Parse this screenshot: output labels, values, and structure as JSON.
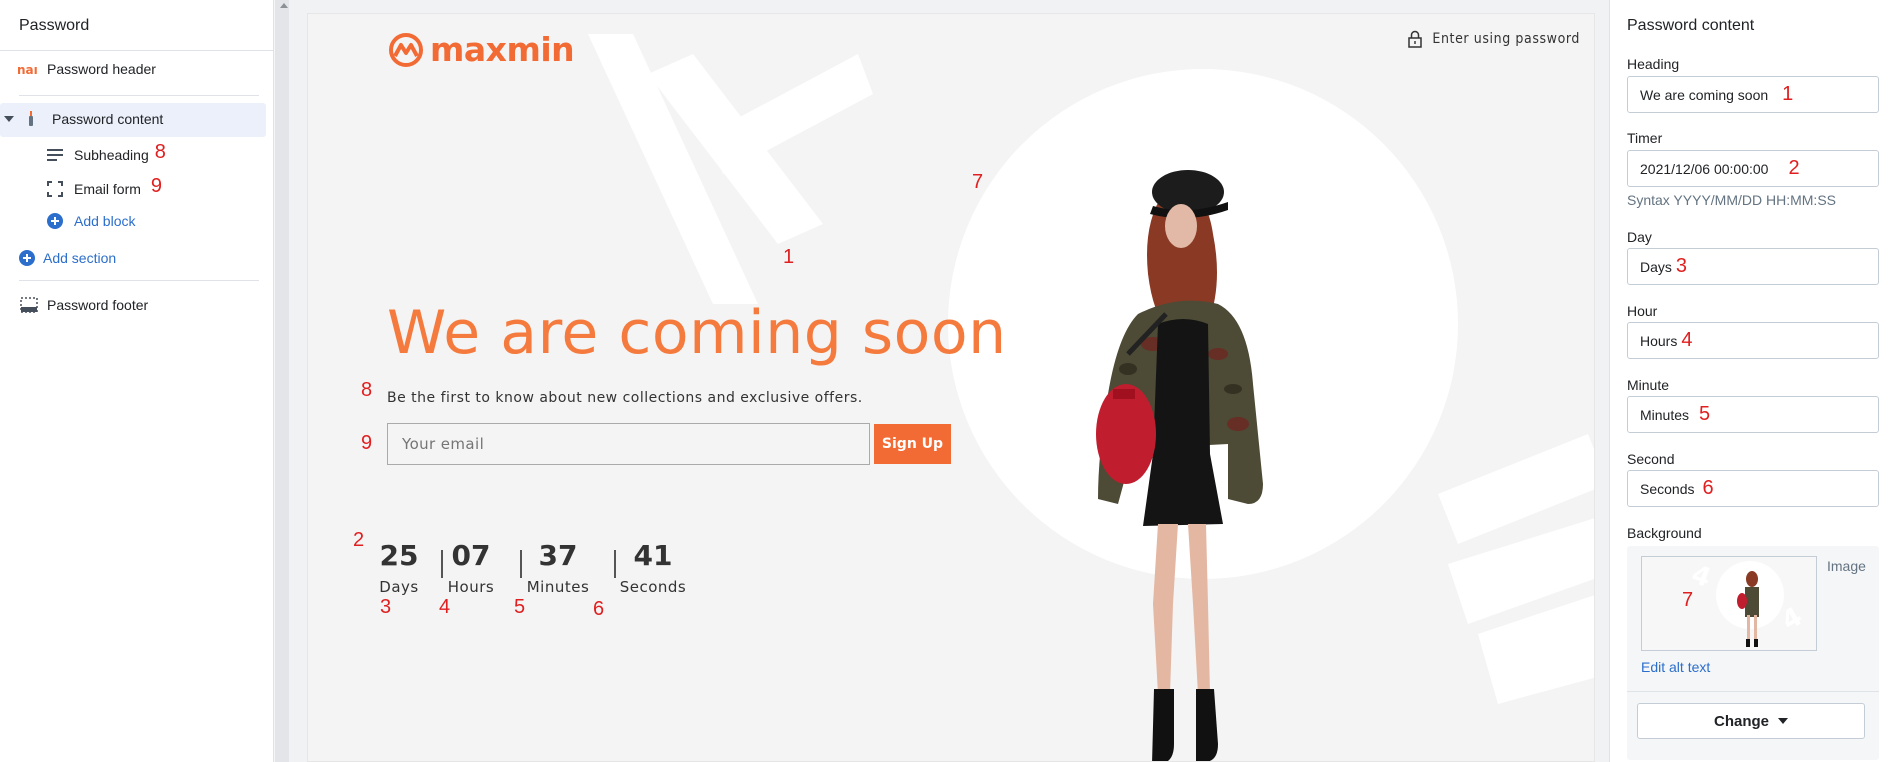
{
  "left": {
    "title": "Password",
    "items": [
      {
        "label": "Password header"
      },
      {
        "label": "Password content"
      },
      {
        "label": "Subheading"
      },
      {
        "label": "Email form"
      },
      {
        "label": "Add block"
      },
      {
        "label": "Add section"
      },
      {
        "label": "Password footer"
      }
    ]
  },
  "preview": {
    "logo_text": "maxmin",
    "enter_password": "Enter using password",
    "heading": "We are coming soon",
    "subheading": "Be the first to know about new collections and exclusive offers.",
    "email_placeholder": "Your email",
    "signup_label": "Sign Up",
    "countdown": [
      {
        "value": "25",
        "label": "Days"
      },
      {
        "value": "07",
        "label": "Hours"
      },
      {
        "value": "37",
        "label": "Minutes"
      },
      {
        "value": "41",
        "label": "Seconds"
      }
    ],
    "bg_text": "404"
  },
  "annotations": {
    "n1": "1",
    "n2": "2",
    "n3": "3",
    "n4": "4",
    "n5": "5",
    "n6": "6",
    "n7": "7",
    "n8": "8",
    "n9": "9"
  },
  "right": {
    "title": "Password content",
    "heading_label": "Heading",
    "heading_value": "We are coming soon",
    "timer_label": "Timer",
    "timer_value": "2021/12/06 00:00:00",
    "timer_hint": "Syntax YYYY/MM/DD HH:MM:SS",
    "day_label": "Day",
    "day_value": "Days",
    "hour_label": "Hour",
    "hour_value": "Hours",
    "minute_label": "Minute",
    "minute_value": "Minutes",
    "second_label": "Second",
    "second_value": "Seconds",
    "background_label": "Background",
    "image_label": "Image",
    "edit_alt": "Edit alt text",
    "change_label": "Change"
  },
  "colors": {
    "brand_orange": "#f26b35",
    "heading_orange": "#f47b3d",
    "annotation_red": "#e02020",
    "link_blue": "#2c6ecb"
  }
}
